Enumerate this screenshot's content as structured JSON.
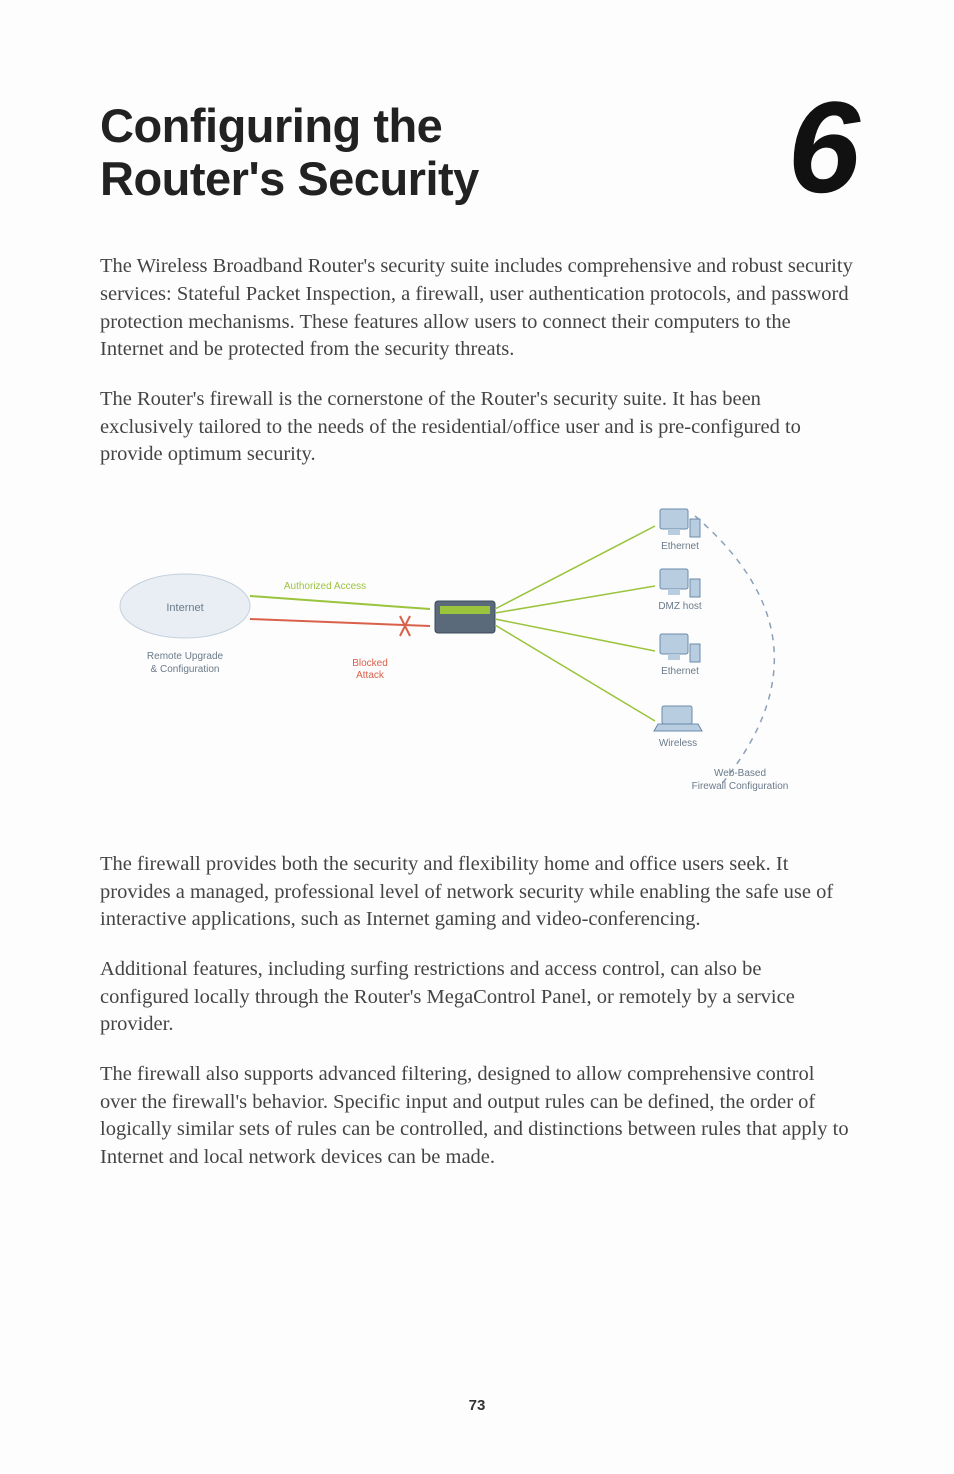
{
  "chapter": {
    "title_line1": "Configuring the",
    "title_line2": "Router's Security",
    "number": "6"
  },
  "paragraphs": {
    "p1": "The Wireless Broadband Router's security suite includes comprehensive and robust security services: Stateful Packet Inspection, a firewall, user authentication protocols, and password protection mechanisms. These features allow users to connect their computers to the Internet and be protected from the security threats.",
    "p2": "The Router's firewall is the cornerstone of the Router's security suite. It has been exclusively tailored to the needs of the residential/office user and is pre-configured to provide optimum security.",
    "p3": "The firewall provides both the security and flexibility home and office users seek. It provides a managed, professional level of network security while enabling the safe use of interactive applications, such as Internet gaming and video-conferencing.",
    "p4": "Additional features, including surfing restrictions and access control, can also be configured locally through the Router's MegaControl Panel, or remotely by a service provider.",
    "p5": "The firewall also supports advanced filtering, designed to allow comprehensive control over the firewall's behavior. Specific input and output rules can be defined, the order of logically similar sets of rules can be controlled, and distinctions between rules that apply to Internet and local network devices can be made."
  },
  "diagram": {
    "internet": "Internet",
    "remote": "Remote Upgrade\n& Configuration",
    "authorized": "Authorized Access",
    "blocked": "Blocked\nAttack",
    "ethernet1": "Ethernet",
    "dmz": "DMZ host",
    "ethernet2": "Ethernet",
    "wireless": "Wireless",
    "webbased": "Web-Based\nFirewall Configuration"
  },
  "page_number": "73"
}
